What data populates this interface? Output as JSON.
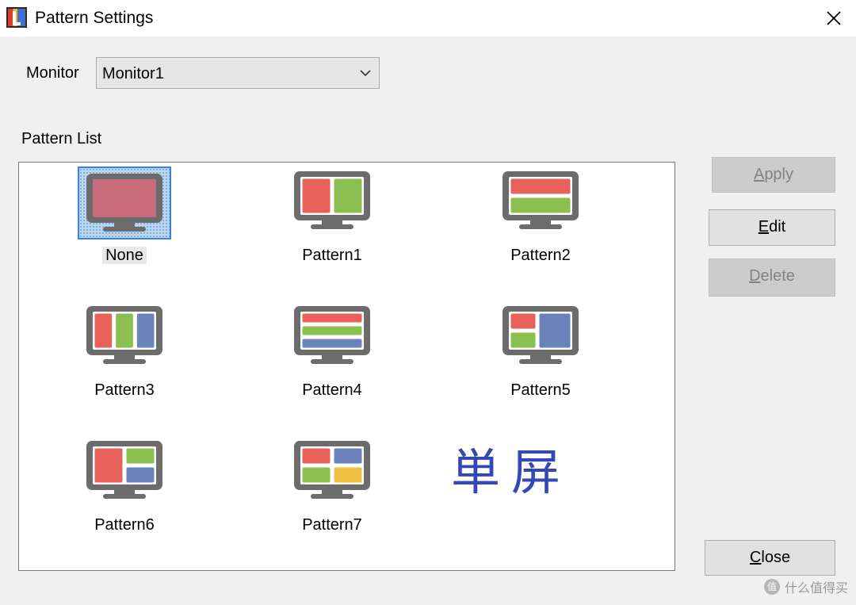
{
  "window": {
    "title": "Pattern Settings"
  },
  "monitor": {
    "label": "Monitor",
    "selected": "Monitor1"
  },
  "patterns": {
    "caption": "Pattern List",
    "items": [
      {
        "label": "None",
        "layout": "none",
        "selected": true
      },
      {
        "label": "Pattern1",
        "layout": "two-columns"
      },
      {
        "label": "Pattern2",
        "layout": "two-rows"
      },
      {
        "label": "Pattern3",
        "layout": "three-columns"
      },
      {
        "label": "Pattern4",
        "layout": "three-rows"
      },
      {
        "label": "Pattern5",
        "layout": "left-two-stacked-right-one"
      },
      {
        "label": "Pattern6",
        "layout": "left-one-right-two-stacked"
      },
      {
        "label": "Pattern7",
        "layout": "quad"
      }
    ],
    "overlay_text": "単屏"
  },
  "buttons": {
    "apply": {
      "label": "Apply",
      "enabled": false
    },
    "edit": {
      "label": "Edit",
      "enabled": true
    },
    "delete": {
      "label": "Delete",
      "enabled": false
    },
    "close": {
      "label": "Close",
      "enabled": true
    }
  },
  "watermark": {
    "badge": "值",
    "text": "什么值得买"
  },
  "colors": {
    "red": "#e8625a",
    "green": "#8bbf4f",
    "blue": "#6b82bb",
    "yellow": "#f0bf3f",
    "frame": "#6c6c6c"
  }
}
